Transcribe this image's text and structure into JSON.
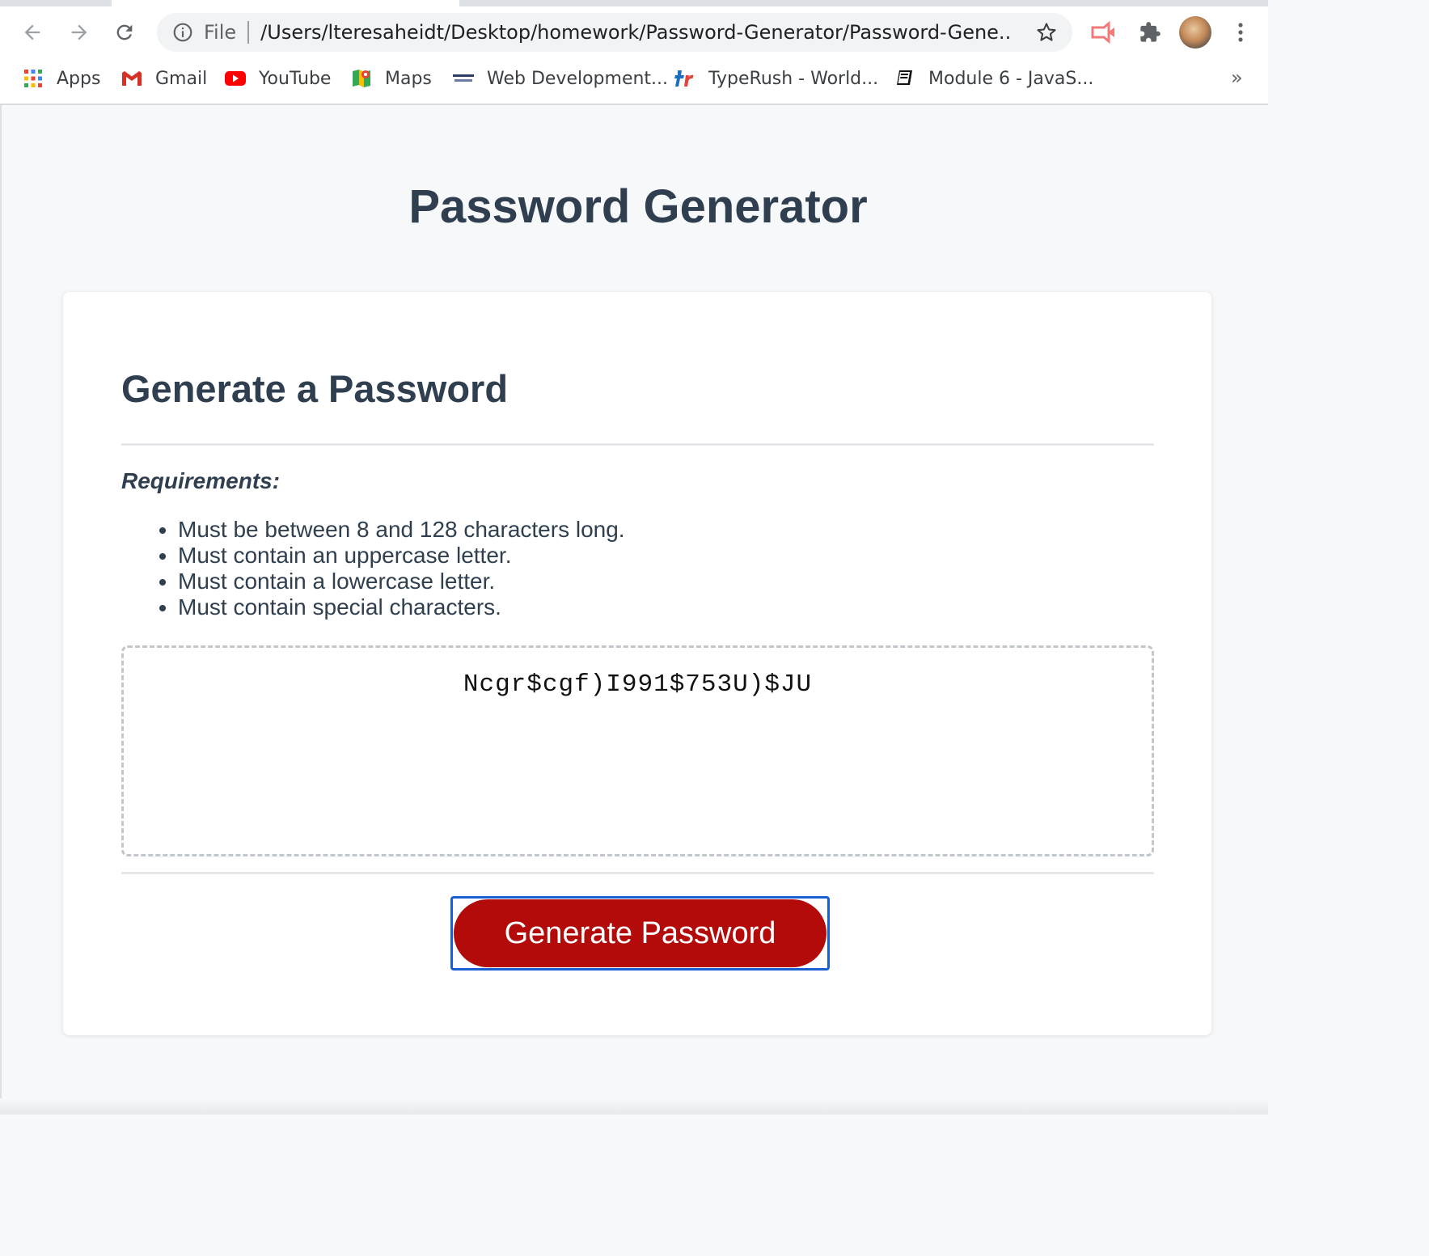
{
  "browser": {
    "url_scheme": "File",
    "url": "/Users/lteresaheidt/Desktop/homework/Password-Generator/Password-Gene...",
    "bookmarks": [
      {
        "label": "Apps",
        "icon": "apps-grid-icon"
      },
      {
        "label": "Gmail",
        "icon": "gmail-icon"
      },
      {
        "label": "YouTube",
        "icon": "youtube-icon"
      },
      {
        "label": "Maps",
        "icon": "maps-icon"
      },
      {
        "label": "Web Development...",
        "icon": "career-services-icon"
      },
      {
        "label": "TypeRush - World...",
        "icon": "typerush-icon"
      },
      {
        "label": "Module 6 - JavaS...",
        "icon": "book-icon"
      }
    ],
    "more_bookmarks": "»"
  },
  "page": {
    "title": "Password Generator",
    "card_title": "Generate a Password",
    "requirements_heading": "Requirements:",
    "requirements": [
      "Must be between 8 and 128 characters long.",
      "Must contain an uppercase letter.",
      "Must contain a lowercase letter.",
      "Must contain special characters."
    ],
    "password": "Ncgr$cgf)I991$753U)$JU",
    "generate_button": "Generate Password"
  },
  "colors": {
    "heading": "#2f3f4f",
    "button": "#b30a0a",
    "focus_ring": "#1a5fd0",
    "background": "#f7f8fa"
  }
}
